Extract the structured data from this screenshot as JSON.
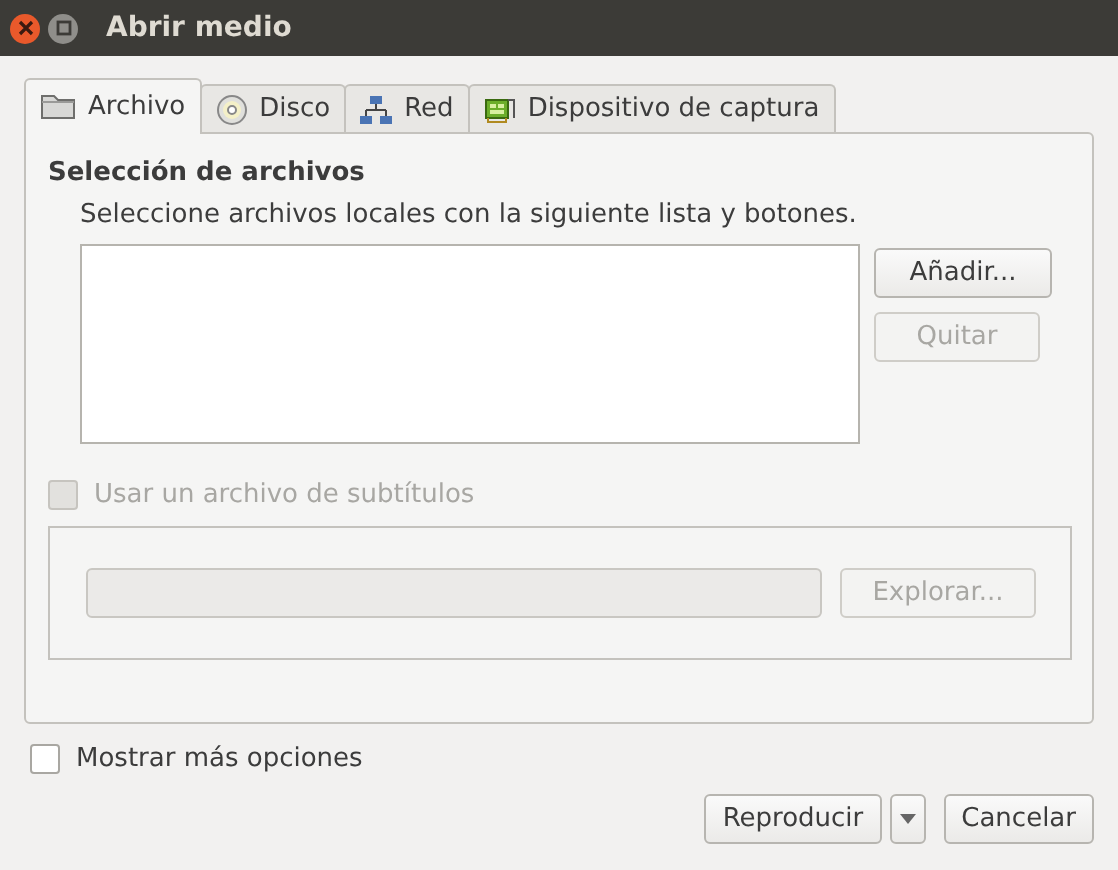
{
  "window": {
    "title": "Abrir medio"
  },
  "tabs": [
    {
      "label": "Archivo",
      "selected": true
    },
    {
      "label": "Disco",
      "selected": false
    },
    {
      "label": "Red",
      "selected": false
    },
    {
      "label": "Dispositivo de captura",
      "selected": false
    }
  ],
  "file_selection": {
    "heading": "Selección de archivos",
    "description": "Seleccione archivos locales con la siguiente lista y botones.",
    "buttons": [
      {
        "label": "Añadir...",
        "disabled": false
      },
      {
        "label": "Quitar",
        "disabled": true
      }
    ]
  },
  "subtitles": {
    "label": "Usar un archivo de subtítulos",
    "checked": false,
    "disabled": true,
    "browse": {
      "label": "Explorar...",
      "disabled": true
    }
  },
  "more_options": {
    "label": "Mostrar más opciones",
    "checked": false,
    "disabled": false
  },
  "buttons": [
    {
      "label": "Reproducir",
      "kind": "split"
    },
    {
      "label": "Cancelar",
      "kind": "plain"
    }
  ]
}
